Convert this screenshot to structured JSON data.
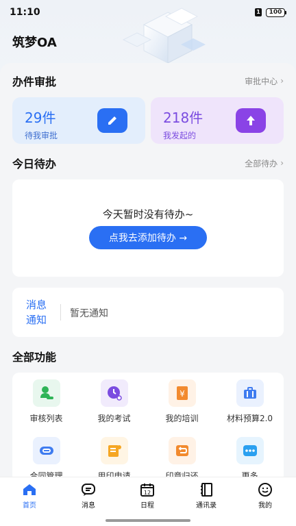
{
  "status_bar": {
    "time": "11:10",
    "sim": "1",
    "battery": "100"
  },
  "app": {
    "title": "筑梦OA"
  },
  "approval": {
    "title": "办件审批",
    "link": "审批中心",
    "pending": {
      "count": "29件",
      "label": "待我审批"
    },
    "initiated": {
      "count": "218件",
      "label": "我发起的"
    }
  },
  "todo": {
    "title": "今日待办",
    "link": "全部待办",
    "empty_text": "今天暂时没有待办~",
    "add_button": "点我去添加待办 →"
  },
  "notice": {
    "label_line1": "消息",
    "label_line2": "通知",
    "text": "暂无通知"
  },
  "functions": {
    "title": "全部功能",
    "items": [
      {
        "label": "审核列表",
        "icon": "audit-icon",
        "color": "#2fb457",
        "bg": "#e8f7ee"
      },
      {
        "label": "我的考试",
        "icon": "exam-icon",
        "color": "#7b4ce0",
        "bg": "#f1ebfc"
      },
      {
        "label": "我的培训",
        "icon": "training-icon",
        "color": "#f28a2e",
        "bg": "#fff2e6"
      },
      {
        "label": "材料预算2.0",
        "icon": "budget-icon",
        "color": "#3f7cf0",
        "bg": "#eaf1fe"
      },
      {
        "label": "合同管理",
        "icon": "contract-icon",
        "color": "#3f7cf0",
        "bg": "#eaf1fe"
      },
      {
        "label": "用印申请",
        "icon": "seal-apply-icon",
        "color": "#f5a623",
        "bg": "#fff5e4"
      },
      {
        "label": "印章归还",
        "icon": "seal-return-icon",
        "color": "#f28a2e",
        "bg": "#fff2e6"
      },
      {
        "label": "更多",
        "icon": "more-icon",
        "color": "#2aa0f0",
        "bg": "#e6f4fe"
      }
    ]
  },
  "tabs": [
    {
      "label": "首页",
      "icon": "home-icon",
      "active": true
    },
    {
      "label": "消息",
      "icon": "message-icon",
      "active": false
    },
    {
      "label": "日程",
      "icon": "calendar-icon",
      "active": false,
      "calendar_day": "12"
    },
    {
      "label": "通讯录",
      "icon": "contacts-icon",
      "active": false
    },
    {
      "label": "我的",
      "icon": "profile-icon",
      "active": false
    }
  ],
  "colors": {
    "accent": "#2a6ff3",
    "purple": "#7b4ce0"
  }
}
